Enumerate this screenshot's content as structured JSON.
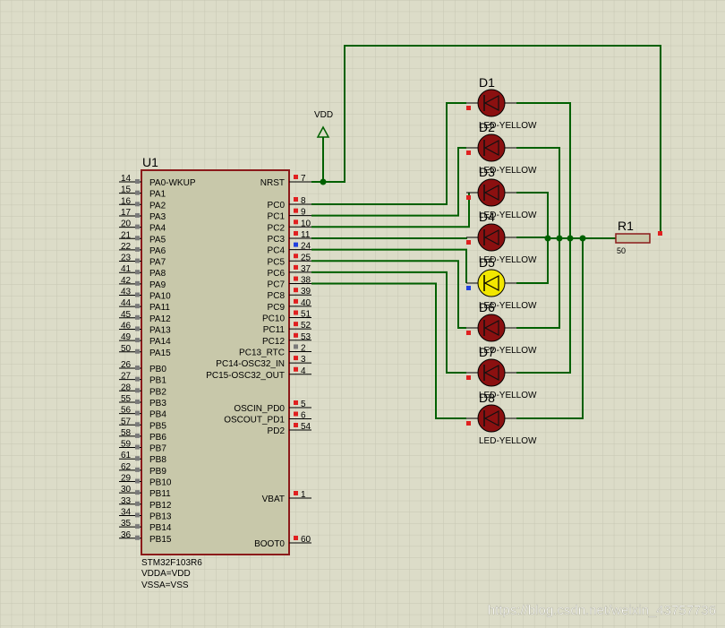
{
  "chip": {
    "ref": "U1",
    "footer": [
      "STM32F103R6",
      "VDDA=VDD",
      "VSSA=VSS"
    ],
    "left_pins": [
      {
        "num": "14",
        "name": "PA0-WKUP"
      },
      {
        "num": "15",
        "name": "PA1"
      },
      {
        "num": "16",
        "name": "PA2"
      },
      {
        "num": "17",
        "name": "PA3"
      },
      {
        "num": "20",
        "name": "PA4"
      },
      {
        "num": "21",
        "name": "PA5"
      },
      {
        "num": "22",
        "name": "PA6"
      },
      {
        "num": "23",
        "name": "PA7"
      },
      {
        "num": "41",
        "name": "PA8"
      },
      {
        "num": "42",
        "name": "PA9"
      },
      {
        "num": "43",
        "name": "PA10"
      },
      {
        "num": "44",
        "name": "PA11"
      },
      {
        "num": "45",
        "name": "PA12"
      },
      {
        "num": "46",
        "name": "PA13"
      },
      {
        "num": "49",
        "name": "PA14"
      },
      {
        "num": "50",
        "name": "PA15"
      },
      {
        "num": "26",
        "name": "PB0"
      },
      {
        "num": "27",
        "name": "PB1"
      },
      {
        "num": "28",
        "name": "PB2"
      },
      {
        "num": "55",
        "name": "PB3"
      },
      {
        "num": "56",
        "name": "PB4"
      },
      {
        "num": "57",
        "name": "PB5"
      },
      {
        "num": "58",
        "name": "PB6"
      },
      {
        "num": "59",
        "name": "PB7"
      },
      {
        "num": "61",
        "name": "PB8"
      },
      {
        "num": "62",
        "name": "PB9"
      },
      {
        "num": "29",
        "name": "PB10"
      },
      {
        "num": "30",
        "name": "PB11"
      },
      {
        "num": "33",
        "name": "PB12"
      },
      {
        "num": "34",
        "name": "PB13"
      },
      {
        "num": "35",
        "name": "PB14"
      },
      {
        "num": "36",
        "name": "PB15"
      }
    ],
    "right_pins": [
      {
        "num": "7",
        "name": "NRST"
      },
      {
        "num": "8",
        "name": "PC0"
      },
      {
        "num": "9",
        "name": "PC1"
      },
      {
        "num": "10",
        "name": "PC2"
      },
      {
        "num": "11",
        "name": "PC3"
      },
      {
        "num": "24",
        "name": "PC4"
      },
      {
        "num": "25",
        "name": "PC5"
      },
      {
        "num": "37",
        "name": "PC6"
      },
      {
        "num": "38",
        "name": "PC7"
      },
      {
        "num": "39",
        "name": "PC8"
      },
      {
        "num": "40",
        "name": "PC9"
      },
      {
        "num": "51",
        "name": "PC10"
      },
      {
        "num": "52",
        "name": "PC11"
      },
      {
        "num": "53",
        "name": "PC12"
      },
      {
        "num": "2",
        "name": "PC13_RTC"
      },
      {
        "num": "3",
        "name": "PC14-OSC32_IN"
      },
      {
        "num": "4",
        "name": "PC15-OSC32_OUT"
      },
      {
        "num": "5",
        "name": "OSCIN_PD0"
      },
      {
        "num": "6",
        "name": "OSCOUT_PD1"
      },
      {
        "num": "54",
        "name": "PD2"
      },
      {
        "num": "1",
        "name": "VBAT"
      },
      {
        "num": "60",
        "name": "BOOT0"
      }
    ]
  },
  "power": {
    "label": "VDD"
  },
  "leds": [
    {
      "ref": "D1",
      "type": "LED-YELLOW",
      "lit": false
    },
    {
      "ref": "D2",
      "type": "LED-YELLOW",
      "lit": false
    },
    {
      "ref": "D3",
      "type": "LED-YELLOW",
      "lit": false
    },
    {
      "ref": "D4",
      "type": "LED-YELLOW",
      "lit": false
    },
    {
      "ref": "D5",
      "type": "LED-YELLOW",
      "lit": true
    },
    {
      "ref": "D6",
      "type": "LED-YELLOW",
      "lit": false
    },
    {
      "ref": "D7",
      "type": "LED-YELLOW",
      "lit": false
    },
    {
      "ref": "D8",
      "type": "LED-YELLOW",
      "lit": false
    }
  ],
  "resistor": {
    "ref": "R1",
    "value": "50"
  },
  "watermark": "https://blog.csdn.net/weixin_43757736",
  "colors": {
    "background": "#dcdcc8",
    "grid": "#c6c6b2",
    "chip_body": "#c8c8aa",
    "chip_border": "#8b1a1a",
    "wire": "#006000",
    "led_off": "#8b1010",
    "led_on": "#f2e600",
    "pin_high": "#e02020",
    "pin_low": "#2040e0",
    "pin_neutral": "#7a7a7a",
    "text": "#000000"
  }
}
